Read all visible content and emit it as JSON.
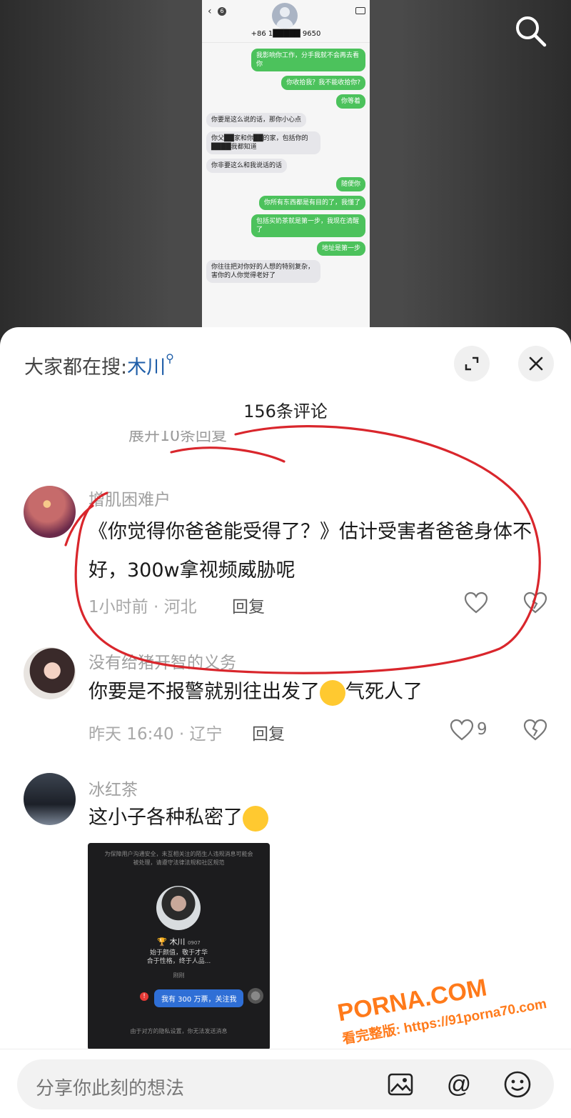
{
  "video": {
    "phone": {
      "contact_number": "+86 1█████ 9650",
      "back_badge": "6",
      "messages": [
        {
          "side": "out",
          "text": "我影响你工作，分手我就不会再去看你"
        },
        {
          "side": "out",
          "text": "你收拾我？我不能收拾你?"
        },
        {
          "side": "out",
          "text": "你等着"
        },
        {
          "side": "in",
          "text": "你要是这么说的话，那你小心点"
        },
        {
          "side": "in",
          "text": "你父██家和你██的家，包括你的████我都知道"
        },
        {
          "side": "in",
          "text": "你非要这么和我说话的话"
        },
        {
          "side": "out",
          "text": "随便你"
        },
        {
          "side": "out",
          "text": "你所有东西都是有目的了，我懂了"
        },
        {
          "side": "out",
          "text": "包括买奶茶就是第一步，我现在清醒了"
        },
        {
          "side": "out",
          "text": "地址是第一步"
        },
        {
          "side": "in",
          "text": "你往往把对你好的人想的特别复杂，害你的人你觉得老好了"
        }
      ]
    }
  },
  "header": {
    "hot_prefix": "大家都在搜:",
    "hot_keyword": "木川",
    "comment_count": "156条评论",
    "partial_expand": "展开10条回复"
  },
  "comments": [
    {
      "username": "增肌困难户",
      "text": "《你觉得你爸爸能受得了？》估计受害者爸爸身体不好，300w拿视频威胁呢",
      "meta": "1小时前 · 河北",
      "reply": "回复",
      "likes": ""
    },
    {
      "username": "没有给猪开智的义务",
      "text": "你要是不报警就别往出发了",
      "text_suffix": "气死人了",
      "meta": "昨天 16:40 · 辽宁",
      "reply": "回复",
      "likes": "9"
    },
    {
      "username": "冰红茶",
      "text": "这小子各种私密了",
      "meta": "",
      "reply": "",
      "likes": ""
    }
  ],
  "image_card": {
    "notice": "为保障用户沟通安全，未互相关注的陌生人违规消息可能会被处理，请遵守法律法规和社区规范",
    "name": "木川",
    "name_suffix": "0907",
    "bio_line1": "始于颜值，敬于才华",
    "bio_line2": "合于性格，终于人品...",
    "date": "刚刚",
    "message": "我有 300 万票，关注我",
    "footer": "由于对方的隐私设置，你无法发送消息"
  },
  "bottom": {
    "placeholder": "分享你此刻的想法"
  },
  "watermark": {
    "main": "PORNA.COM",
    "sub": "看完整版: https://91porna70.com"
  },
  "colors": {
    "keyword": "#1f5ea8",
    "annotation_red": "#d9262c",
    "bubble_green": "#4cc25c"
  },
  "icons": [
    "search-icon",
    "expand-icon",
    "close-icon",
    "heart-icon",
    "broken-heart-icon",
    "image-icon",
    "at-icon",
    "emoji-icon"
  ]
}
